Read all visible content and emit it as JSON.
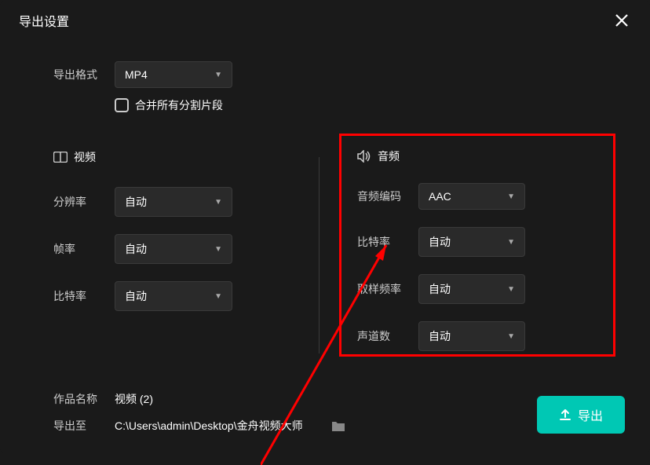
{
  "dialog": {
    "title": "导出设置"
  },
  "format": {
    "label": "导出格式",
    "value": "MP4",
    "merge_label": "合并所有分割片段"
  },
  "video": {
    "section_title": "视频",
    "resolution_label": "分辨率",
    "resolution_value": "自动",
    "fps_label": "帧率",
    "fps_value": "自动",
    "bitrate_label": "比特率",
    "bitrate_value": "自动"
  },
  "audio": {
    "section_title": "音频",
    "codec_label": "音频编码",
    "codec_value": "AAC",
    "bitrate_label": "比特率",
    "bitrate_value": "自动",
    "sample_label": "取样频率",
    "sample_value": "自动",
    "channels_label": "声道数",
    "channels_value": "自动"
  },
  "footer": {
    "name_label": "作品名称",
    "name_value": "视频 (2)",
    "path_label": "导出至",
    "path_value": "C:\\Users\\admin\\Desktop\\金舟视频大师",
    "export_label": "导出"
  }
}
